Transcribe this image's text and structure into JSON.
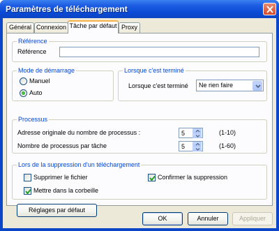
{
  "window": {
    "title": "Paramètres de téléchargement"
  },
  "tabs": [
    {
      "label": "Général"
    },
    {
      "label": "Connexion"
    },
    {
      "label": "Tâche par défaut"
    },
    {
      "label": "Proxy"
    }
  ],
  "reference": {
    "legend": "Référence",
    "label": "Référence",
    "value": ""
  },
  "start_mode": {
    "legend": "Mode de démarrage",
    "options": [
      {
        "label": "Manuel",
        "selected": false
      },
      {
        "label": "Auto",
        "selected": true
      }
    ]
  },
  "on_finish": {
    "legend": "Lorsque c'est terminé",
    "label": "Lorsque c'est terminé",
    "selected": "Ne rien faire"
  },
  "processes": {
    "legend": "Processus",
    "rows": [
      {
        "label": "Adresse originale du nombre de processus :",
        "value": "5",
        "range": "(1-10)"
      },
      {
        "label": "Nombre de processus par tâche",
        "value": "5",
        "range": "(1-60)"
      }
    ]
  },
  "deletion": {
    "legend": "Lors de la suppression d'un téléchargement",
    "delete_file": {
      "label": "Supprimer le fichier",
      "checked": false
    },
    "confirm": {
      "label": "Confirmer la suppression",
      "checked": true
    },
    "recycle": {
      "label": "Mettre dans la corbeille",
      "checked": true
    }
  },
  "buttons": {
    "defaults": "Réglages par défaut",
    "ok": "OK",
    "cancel": "Annuler",
    "apply": "Appliquer"
  }
}
